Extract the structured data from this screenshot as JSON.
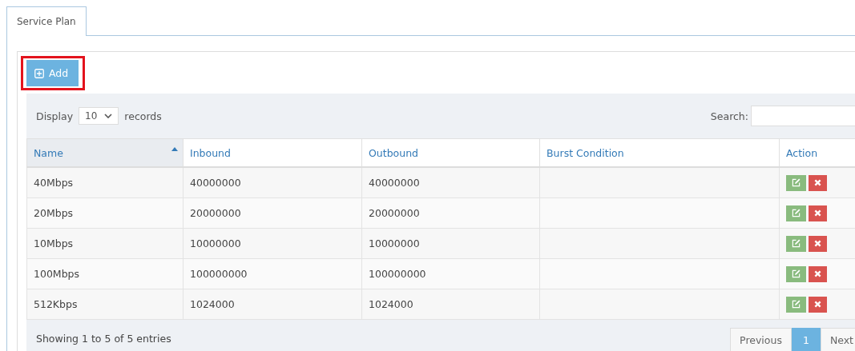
{
  "tabs": [
    {
      "label": "Service Plan",
      "selected": true
    }
  ],
  "add_button": {
    "label": "Add"
  },
  "length_control": {
    "label_before": "Display",
    "value": "10",
    "label_after": "records"
  },
  "search": {
    "label": "Search:"
  },
  "table": {
    "columns": [
      {
        "label": "Name",
        "sorted": true
      },
      {
        "label": "Inbound",
        "sorted": false
      },
      {
        "label": "Outbound",
        "sorted": false
      },
      {
        "label": "Burst Condition",
        "sorted": false
      },
      {
        "label": "Action",
        "sorted": false
      }
    ],
    "rows": [
      {
        "name": "40Mbps",
        "inbound": "40000000",
        "outbound": "40000000"
      },
      {
        "name": "20Mbps",
        "inbound": "20000000",
        "outbound": "20000000"
      },
      {
        "name": "10Mbps",
        "inbound": "10000000",
        "outbound": "10000000"
      },
      {
        "name": "100Mbps",
        "inbound": "100000000",
        "outbound": "100000000"
      },
      {
        "name": "512Kbps",
        "inbound": "1024000",
        "outbound": "1024000"
      }
    ]
  },
  "info": "Showing 1 to 5 of 5 entries",
  "pagination": [
    {
      "label": "Previous",
      "kind": "prev",
      "selected": false
    },
    {
      "label": "1",
      "kind": "page",
      "selected": true
    },
    {
      "label": "Next",
      "kind": "next",
      "selected": false
    }
  ]
}
